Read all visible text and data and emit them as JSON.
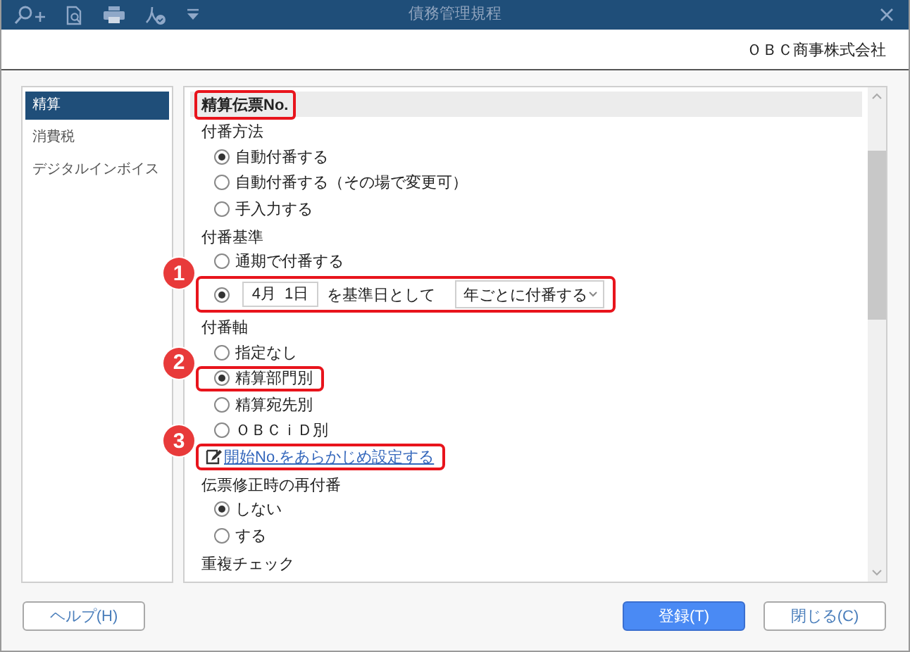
{
  "window": {
    "title": "債務管理規程"
  },
  "company": "ＯＢＣ商事株式会社",
  "sidebar": {
    "items": [
      {
        "label": "精算",
        "selected": true
      },
      {
        "label": "消費税",
        "selected": false
      },
      {
        "label": "デジタルインボイス",
        "selected": false
      }
    ]
  },
  "section": {
    "title": "精算伝票No.",
    "highlighted": true
  },
  "groups": [
    {
      "label": "付番方法",
      "options": [
        {
          "kind": "radio",
          "label": "自動付番する",
          "selected": true
        },
        {
          "kind": "radio",
          "label": "自動付番する（その場で変更可）",
          "selected": false
        },
        {
          "kind": "radio",
          "label": "手入力する",
          "selected": false
        }
      ]
    },
    {
      "label": "付番基準",
      "options": [
        {
          "kind": "radio",
          "label": "通期で付番する",
          "selected": false
        },
        {
          "kind": "date-radio",
          "selected": true,
          "date": "4月  1日",
          "text": "を基準日として",
          "dropdown": "年ごとに付番する",
          "callout": "1"
        }
      ]
    },
    {
      "label": "付番軸",
      "options": [
        {
          "kind": "radio",
          "label": "指定なし",
          "selected": false
        },
        {
          "kind": "radio",
          "label": "精算部門別",
          "selected": true,
          "callout": "2"
        },
        {
          "kind": "radio",
          "label": "精算宛先別",
          "selected": false
        },
        {
          "kind": "radio",
          "label": "ＯＢＣｉＤ別",
          "selected": false
        },
        {
          "kind": "link",
          "label": "開始No.をあらかじめ設定する",
          "callout": "3"
        }
      ]
    },
    {
      "label": "伝票修正時の再付番",
      "options": [
        {
          "kind": "radio",
          "label": "しない",
          "selected": true
        },
        {
          "kind": "radio",
          "label": "する",
          "selected": false
        }
      ]
    },
    {
      "label": "重複チェック"
    }
  ],
  "buttons": [
    {
      "label": "ヘルプ(H)",
      "kind": "secondary"
    },
    {
      "label": "登録(T)",
      "kind": "primary"
    },
    {
      "label": "閉じる(C)",
      "kind": "secondary"
    }
  ]
}
